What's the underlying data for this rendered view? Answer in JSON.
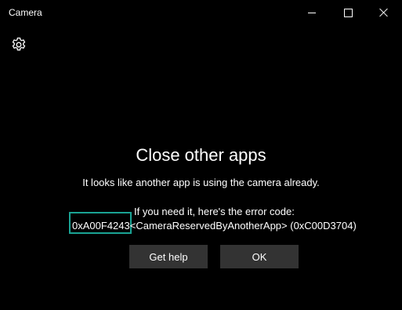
{
  "window": {
    "title": "Camera"
  },
  "toolbar": {
    "settings_icon": "gear-icon"
  },
  "dialog": {
    "heading": "Close other apps",
    "message": "It looks like another app is using the camera already.",
    "error_intro": "If you need it, here's the error code:",
    "error_code": "0xA00F4243",
    "error_detail": "<CameraReservedByAnotherApp> (0xC00D3704)",
    "buttons": {
      "help": "Get help",
      "ok": "OK"
    }
  },
  "colors": {
    "background": "#000000",
    "text": "#ffffff",
    "button_bg": "#333333",
    "highlight": "#1aa394"
  }
}
